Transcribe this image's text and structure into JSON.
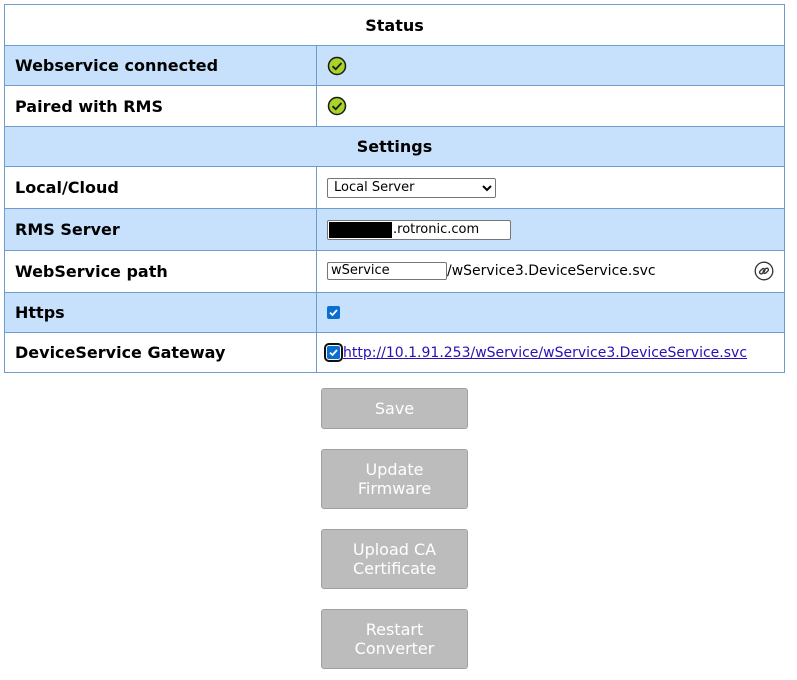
{
  "status": {
    "title": "Status",
    "rows": [
      {
        "label": "Webservice connected",
        "icon": "check-circle-icon"
      },
      {
        "label": "Paired with RMS",
        "icon": "check-circle-icon"
      }
    ]
  },
  "settings": {
    "title": "Settings",
    "local_cloud": {
      "label": "Local/Cloud",
      "selected": "Local Server"
    },
    "rms_server": {
      "label": "RMS Server",
      "value_suffix": ".rotronic.com"
    },
    "webservice_path": {
      "label": "WebService path",
      "input_value": "wService",
      "suffix": "/wService3.DeviceService.svc",
      "icon": "link-icon"
    },
    "https": {
      "label": "Https",
      "checked": true
    },
    "gateway": {
      "label": "DeviceService Gateway",
      "checked": true,
      "link": "http://10.1.91.253/wService/wService3.DeviceService.svc"
    }
  },
  "buttons": {
    "save": "Save",
    "update_firmware": "Update\nFirmware",
    "upload_ca": "Upload CA\nCertificate",
    "restart": "Restart\nConverter"
  },
  "colors": {
    "row_blue": "#c7e0fb",
    "border": "#6f9ccc",
    "check_green": "#a8d42a",
    "button_gray": "#bcbcbc",
    "link": "#2b0fb8"
  }
}
